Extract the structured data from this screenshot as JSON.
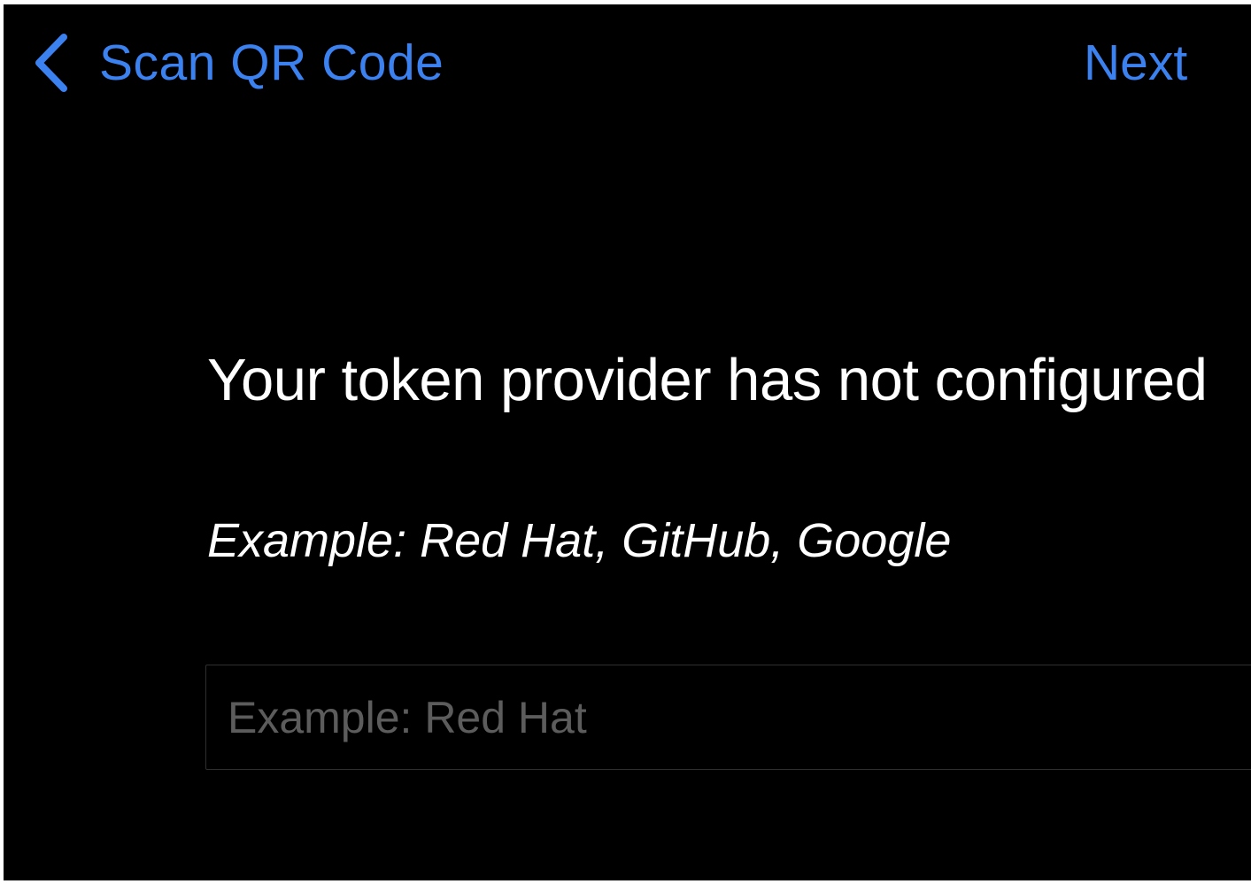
{
  "theme": {
    "accent": "#3b82f0",
    "background": "#000000",
    "text": "#ffffff"
  },
  "nav": {
    "back_icon": "chevron-left-icon",
    "back_label": "Scan QR Code",
    "next_label": "Next"
  },
  "content": {
    "heading": "Your token provider has not configured",
    "hint": "Example: Red Hat, GitHub, Google"
  },
  "provider_field": {
    "value": "",
    "placeholder": "Example: Red Hat"
  }
}
